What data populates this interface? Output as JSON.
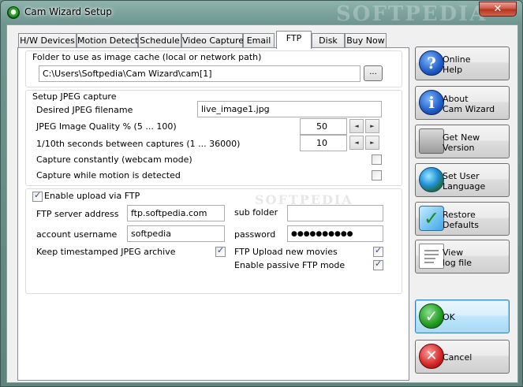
{
  "window": {
    "title": "Cam Wizard Setup",
    "close_glyph": "✕",
    "watermark": "SOFTPEDIA"
  },
  "tabs": [
    "H/W Devices",
    "Motion Detect",
    "Schedule",
    "Video Capture",
    "Email",
    "FTP",
    "Disk",
    "Buy Now"
  ],
  "active_tab": "FTP",
  "cache": {
    "label": "Folder to use as image cache (local or network path)",
    "path": "C:\\Users\\Softpedia\\Cam Wizard\\cam[1]",
    "browse_label": "..."
  },
  "jpeg": {
    "section_label": "Setup JPEG capture",
    "filename_label": "Desired JPEG filename",
    "filename_value": "live_image1.jpg",
    "quality_label": "JPEG Image Quality % (5 ... 100)",
    "quality_value": "50",
    "interval_label": "1/10th seconds between captures (1 ... 36000)",
    "interval_value": "10",
    "constant_label": "Capture constantly (webcam mode)",
    "constant_checked": false,
    "motion_label": "Capture while motion is detected",
    "motion_checked": false,
    "spin_left": "◄",
    "spin_right": "►"
  },
  "ftp": {
    "enable_label": "Enable upload via FTP",
    "enable_checked": true,
    "server_label": "FTP server address",
    "server_value": "ftp.softpedia.com",
    "subfolder_label": "sub folder",
    "subfolder_value": "",
    "user_label": "account username",
    "user_value": "softpedia",
    "password_label": "password",
    "password_value": "●●●●●●●●●●",
    "keep_label": "Keep timestamped JPEG archive",
    "keep_checked": true,
    "movies_label": "FTP Upload new movies",
    "movies_checked": true,
    "passive_label": "Enable passive FTP mode",
    "passive_checked": true
  },
  "side_buttons": {
    "help": "Online\nHelp",
    "about": "About\nCam Wizard",
    "update": "Get New\nVersion",
    "language": "Set User\nLanguage",
    "restore": "Restore\nDefaults",
    "log": "View\nlog file",
    "ok": "OK",
    "cancel": "Cancel"
  },
  "icons": {
    "help": "help-icon",
    "about": "info-icon",
    "update": "update-icon",
    "language": "globe-icon",
    "restore": "checkmark-icon",
    "log": "log-file-icon",
    "ok": "ok-icon",
    "cancel": "cancel-icon"
  },
  "colors": {
    "accent": "#3c7fb1",
    "close": "#c23c2a"
  }
}
